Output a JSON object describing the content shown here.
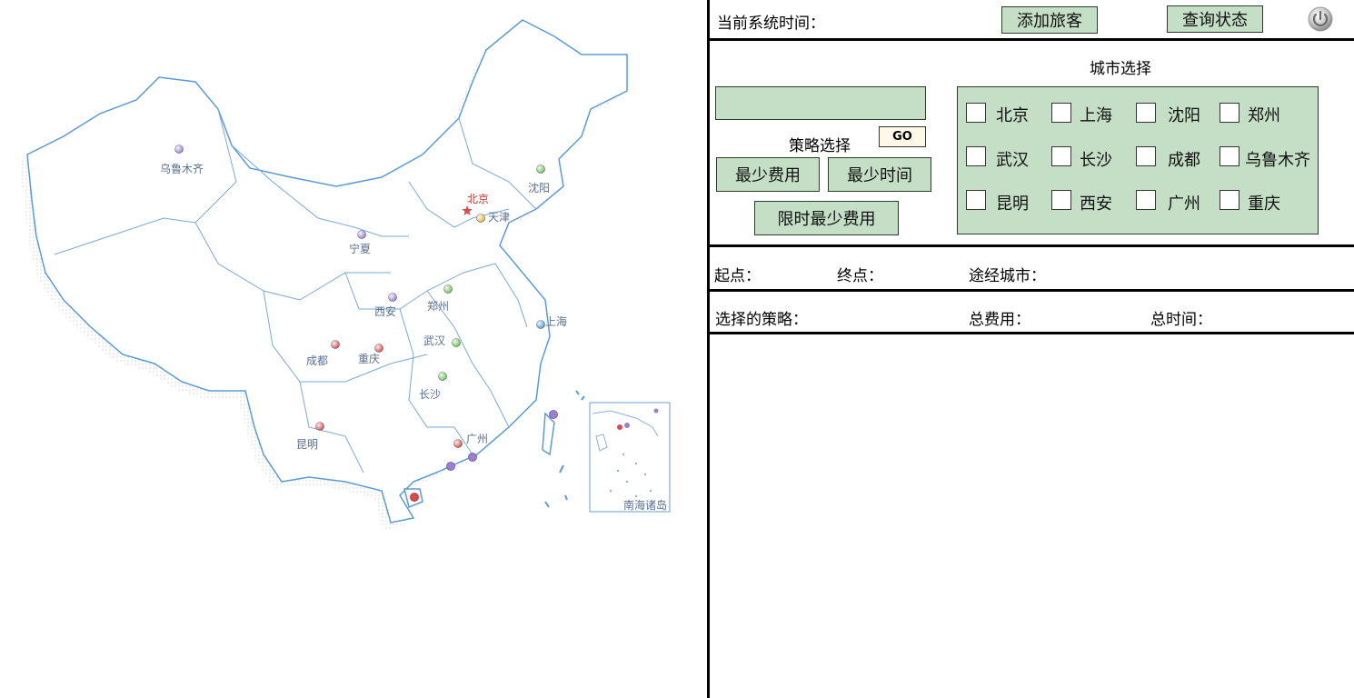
{
  "map": {
    "cities": [
      {
        "name": "乌鲁木齐",
        "color": "#9a7fd1"
      },
      {
        "name": "北京",
        "color": "#d94c4c"
      },
      {
        "name": "天津",
        "color": "#e3b23c"
      },
      {
        "name": "沈阳",
        "color": "#6cc35a"
      },
      {
        "name": "宁夏",
        "color": "#9a7fd1"
      },
      {
        "name": "西安",
        "color": "#9a7fd1"
      },
      {
        "name": "郑州",
        "color": "#6cc35a"
      },
      {
        "name": "上海",
        "color": "#4a9ad4"
      },
      {
        "name": "武汉",
        "color": "#6cc35a"
      },
      {
        "name": "成都",
        "color": "#d94c4c"
      },
      {
        "name": "重庆",
        "color": "#d94c4c"
      },
      {
        "name": "长沙",
        "color": "#6cc35a"
      },
      {
        "name": "昆明",
        "color": "#d94c4c"
      },
      {
        "name": "广州",
        "color": "#d94c4c"
      }
    ],
    "inset_label": "南海诸岛"
  },
  "header": {
    "system_time_label": "当前系统时间：",
    "add_passenger_button": "添加旅客",
    "query_status_button": "查询状态",
    "power_icon": "power-icon"
  },
  "city_selection": {
    "title": "城市选择",
    "cities": [
      "北京",
      "上海",
      "沈阳",
      "郑州",
      "武汉",
      "长沙",
      "成都",
      "乌鲁木齐",
      "昆明",
      "西安",
      "广州",
      "重庆"
    ]
  },
  "strategy": {
    "input_value": "",
    "go_button": "GO",
    "label": "策略选择",
    "min_cost_button": "最少费用",
    "min_time_button": "最少时间",
    "time_limited_min_cost_button": "限时最少费用"
  },
  "route": {
    "origin_label": "起点：",
    "destination_label": "终点：",
    "via_label": "途经城市："
  },
  "summary": {
    "chosen_strategy_label": "选择的策略：",
    "total_cost_label": "总费用：",
    "total_time_label": "总时间："
  }
}
